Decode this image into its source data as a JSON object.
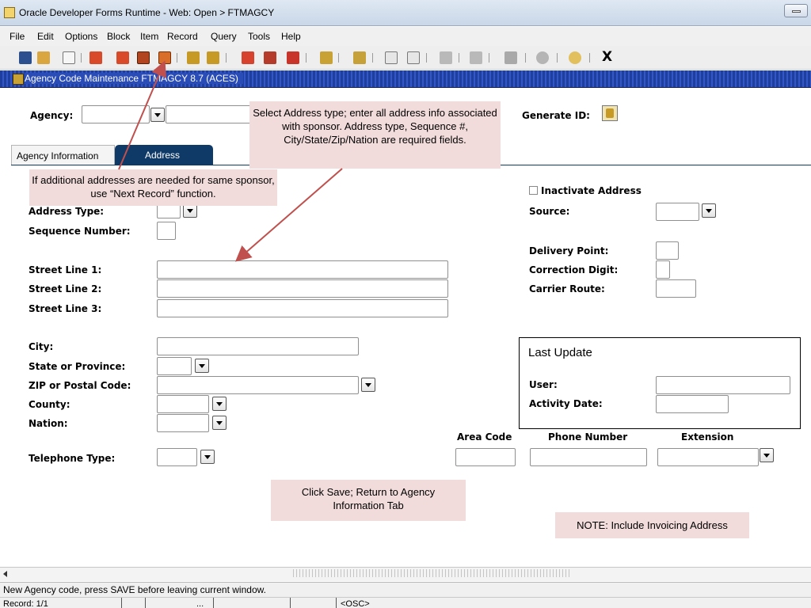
{
  "window": {
    "title": "Oracle Developer Forms Runtime - Web:  Open > FTMAGCY"
  },
  "menu": [
    "File",
    "Edit",
    "Options",
    "Block",
    "Item",
    "Record",
    "Query",
    "Tools",
    "Help"
  ],
  "toolbar": {
    "exit_label": "X",
    "icons": [
      "save-icon",
      "rollback-icon",
      "print-icon",
      "previous-block-icon",
      "previous-record-icon",
      "next-record-icon",
      "next-record-highlight-icon",
      "insert-record-icon",
      "remove-record-icon",
      "options-icon",
      "extract-icon",
      "menu-icon",
      "export-icon",
      "lock-icon",
      "query-icon",
      "execute-query-icon",
      "cancel-icon",
      "item-properties-icon",
      "help-icon",
      "idea-icon"
    ]
  },
  "form": {
    "title": "Agency Code Maintenance  FTMAGCY  8.7  (ACES)"
  },
  "key_block": {
    "agency_label": "Agency:",
    "agency_value": "",
    "agency_name_value": "",
    "generate_id_label": "Generate ID:"
  },
  "tabs": [
    {
      "label": "Agency Information",
      "active": false
    },
    {
      "label": "Address",
      "active": true
    }
  ],
  "address": {
    "address_type_label": "Address Type:",
    "sequence_label": "Sequence Number:",
    "street1_label": "Street Line 1:",
    "street2_label": "Street Line 2:",
    "street3_label": "Street Line 3:",
    "city_label": "City:",
    "state_label": "State or Province:",
    "zip_label": "ZIP or Postal Code:",
    "county_label": "County:",
    "nation_label": "Nation:",
    "telephone_type_label": "Telephone Type:",
    "inactivate_label": "Inactivate Address",
    "source_label": "Source:",
    "delivery_point_label": "Delivery Point:",
    "correction_digit_label": "Correction Digit:",
    "carrier_route_label": "Carrier Route:",
    "area_code_label": "Area Code",
    "phone_number_label": "Phone Number",
    "extension_label": "Extension"
  },
  "last_update": {
    "title": "Last Update",
    "user_label": "User:",
    "activity_date_label": "Activity Date:"
  },
  "callouts": {
    "address_info": "Select Address type; enter all address info associated with sponsor. Address type, Sequence #, City/State/Zip/Nation are required fields.",
    "next_record": "If additional addresses are needed for same sponsor, use “Next Record” function.",
    "save": "Click Save; Return to Agency Information Tab",
    "note": "NOTE: Include Invoicing Address"
  },
  "status": {
    "message": "New Agency code, press SAVE before leaving current window.",
    "record": "Record: 1/1",
    "ellipsis": "...",
    "osc": "<OSC>"
  }
}
